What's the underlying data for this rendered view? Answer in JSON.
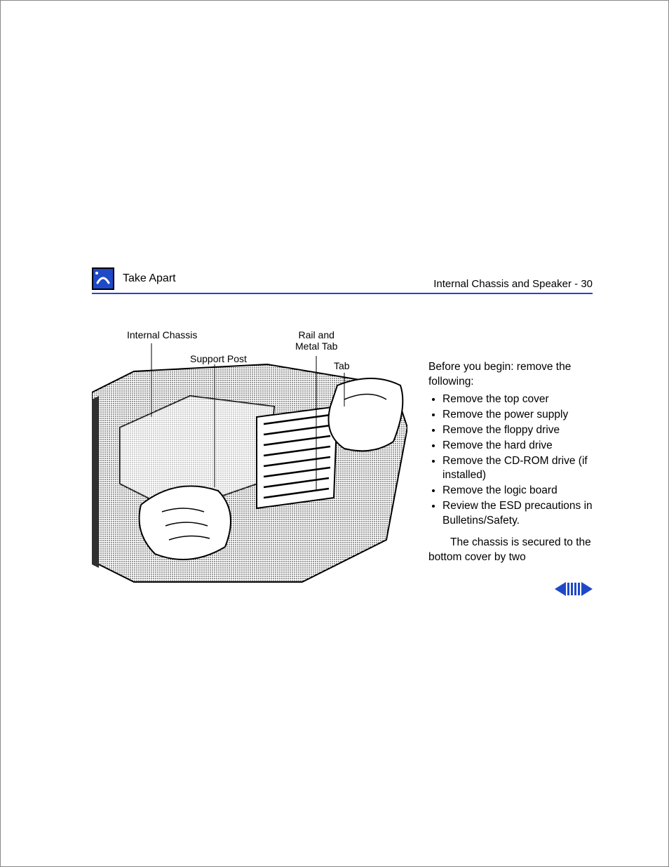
{
  "header": {
    "section": "Take Apart",
    "page_title": "Internal Chassis and Speaker - 30"
  },
  "figure": {
    "callouts": {
      "internal_chassis": "Internal Chassis",
      "support_post": "Support Post",
      "rail_metal_tab": "Rail and\nMetal Tab",
      "tab": "Tab"
    }
  },
  "body": {
    "intro": "Before you begin: remove the following:",
    "list": [
      "Remove the top cover",
      "Remove the power supply",
      "Remove the floppy drive",
      "Remove the hard drive",
      "Remove the CD-ROM drive (if installed)",
      "Remove the logic board",
      "Review the ESD precautions in Bulletins/Safety."
    ],
    "tail": "The chassis is secured to the bottom cover by two"
  }
}
